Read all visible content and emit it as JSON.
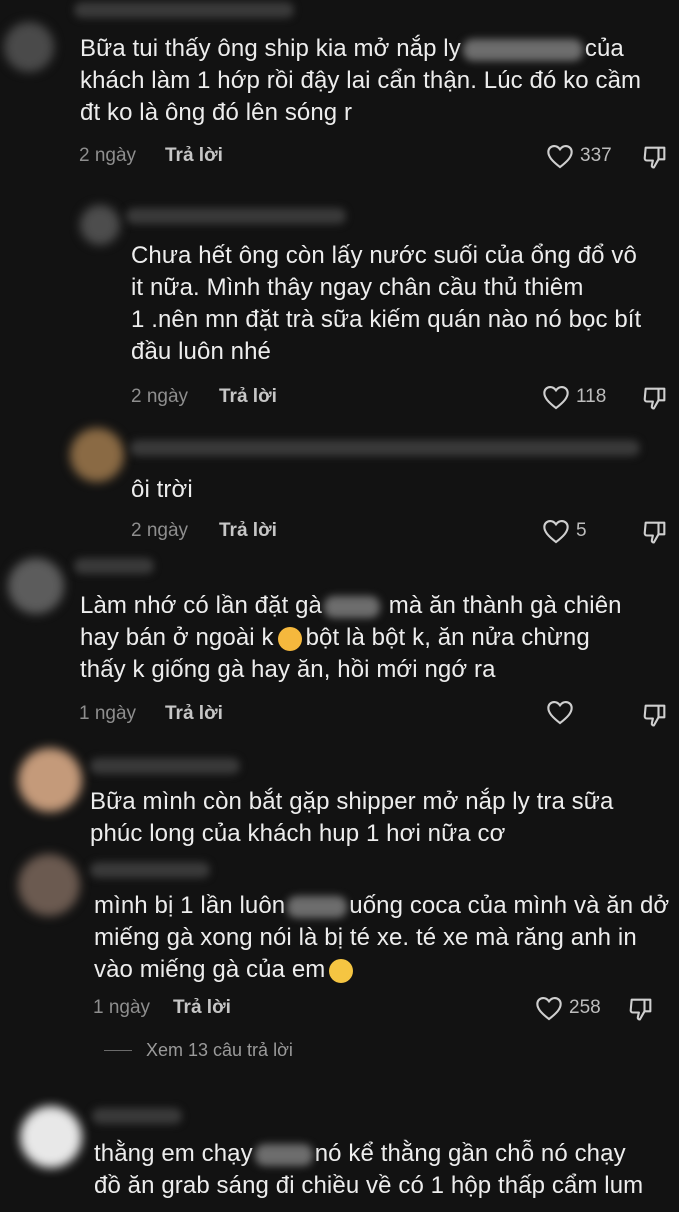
{
  "comments": [
    {
      "text_a": "Bữa tui thấy ông ship kia mở nắp ly",
      "text_b": "của\nkhách làm 1 hớp rồi đậy lai cẩn thận. Lúc đó ko cầm\nđt ko là ông đó lên sóng r",
      "time": "2 ngày",
      "reply": "Trả lời",
      "likes": "337"
    },
    {
      "text": "Chưa hết ông còn lấy nước suối của ổng đổ vô\nit nữa. Mình thây ngay chân cầu thủ thiêm\n1 .nên mn đặt trà sữa kiếm quán nào nó bọc bít\nđầu luôn nhé",
      "time": "2 ngày",
      "reply": "Trả lời",
      "likes": "118"
    },
    {
      "text": "ôi trời",
      "time": "2 ngày",
      "reply": "Trả lời",
      "likes": "5"
    },
    {
      "text_a": "Làm nhớ có lần đặt gà",
      "text_b": "mà ăn thành gà chiên",
      "text_c": "hay bán ở ngoài k",
      "text_d": "bột là bột k, ăn nửa chừng",
      "text_e": "thấy k giống gà hay ăn, hồi mới ngớ ra",
      "time": "1 ngày",
      "reply": "Trả lời"
    },
    {
      "text": "Bữa mình còn bắt gặp shipper mở nắp ly tra sữa\nphúc long của khách hup 1 hơi nữa cơ"
    },
    {
      "text_a": "mình bị 1 lần luôn",
      "text_b": "uống coca của mình và ăn dở",
      "text_c": "miếng gà xong nói là bị té xe. té xe mà răng anh in\nvào miếng gà của em",
      "time": "1 ngày",
      "reply": "Trả lời",
      "likes": "258"
    },
    {
      "text_a": "thằng em chạy",
      "text_b": "nó kể thằng gần chỗ nó chạy",
      "text_c": "đồ ăn grab sáng đi chiều về có 1 hộp thấp cẩm lum"
    }
  ],
  "view_replies": "Xem 13 câu trả lời",
  "icons": {
    "like": "heart-icon",
    "dislike": "thumbs-down-icon",
    "emoji1": "upside-down-face-emoji",
    "emoji2": "pleading-face-emoji"
  },
  "colors": {
    "background": "#121212",
    "text": "#ededed",
    "meta": "#8e8e8e"
  }
}
